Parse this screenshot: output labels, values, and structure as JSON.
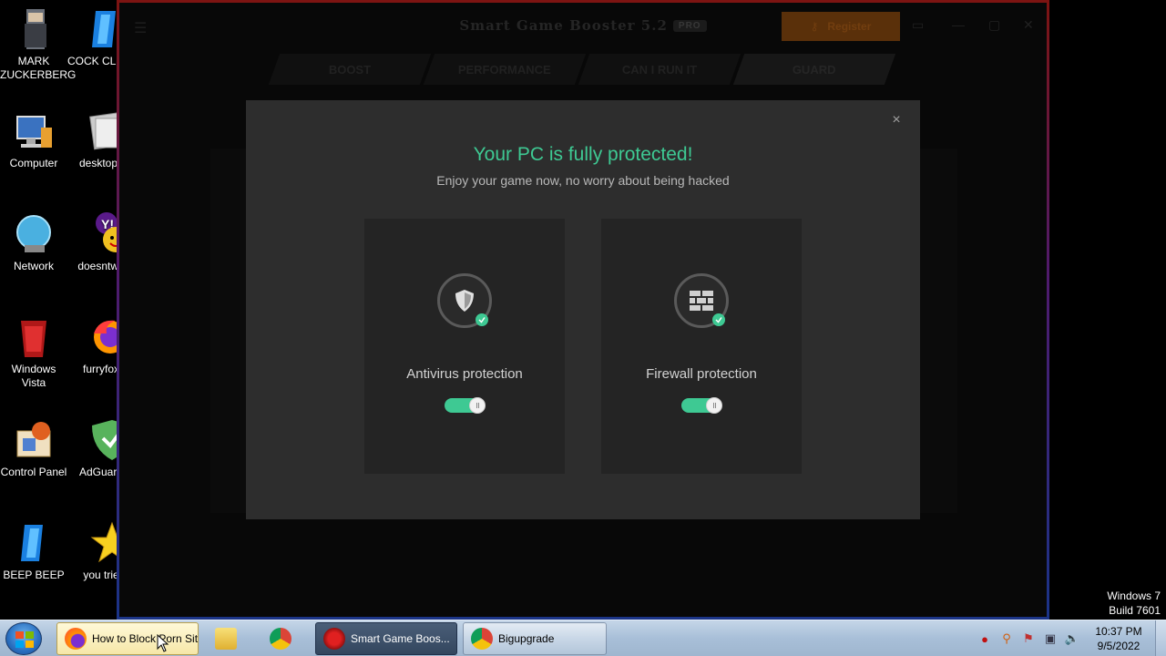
{
  "desktop": {
    "icons": [
      {
        "label": "MARK ZUCKERBERG",
        "icon": "character-icon"
      },
      {
        "label": "COCK CLEANE",
        "icon": "cleaner-icon"
      },
      {
        "label": "Computer",
        "icon": "computer-icon"
      },
      {
        "label": "desktop.i",
        "icon": "file-icon"
      },
      {
        "label": "Network",
        "icon": "network-icon"
      },
      {
        "label": "doesntwo",
        "icon": "yahoo-messenger-icon"
      },
      {
        "label": "Windows Vista",
        "icon": "recycle-bin-icon"
      },
      {
        "label": "furryfox",
        "icon": "firefox-icon"
      },
      {
        "label": "Control Panel",
        "icon": "control-panel-icon"
      },
      {
        "label": "AdGuard",
        "icon": "adguard-icon"
      },
      {
        "label": "BEEP BEEP",
        "icon": "cleaner-icon"
      },
      {
        "label": "you trie",
        "icon": "star-icon"
      }
    ],
    "watermark_line1": "Windows 7",
    "watermark_line2": "Build 7601"
  },
  "game_booster": {
    "title": "Smart Game Booster 5.2",
    "badge": "PRO",
    "register_label": "Register",
    "tabs": [
      "BOOST",
      "PERFORMANCE",
      "CAN I RUN IT",
      "GUARD"
    ],
    "active_tab": "GUARD"
  },
  "dialog": {
    "title": "Your PC is fully protected!",
    "subtitle": "Enjoy your game now, no worry about being hacked",
    "close_glyph": "×",
    "cards": [
      {
        "label": "Antivirus protection",
        "icon": "shield-icon",
        "enabled": true
      },
      {
        "label": "Firewall protection",
        "icon": "brick-wall-icon",
        "enabled": true
      }
    ],
    "accent_color": "#3ec993"
  },
  "taskbar": {
    "items": [
      {
        "label": "How to Block Porn Site",
        "icon": "firefox-icon"
      },
      {
        "label": "",
        "icon": "folder-icon"
      },
      {
        "label": "",
        "icon": "chrome-icon"
      },
      {
        "label": "Smart Game Boos...",
        "icon": "game-booster-icon"
      },
      {
        "label": "Bigupgrade",
        "icon": "chrome-icon"
      }
    ],
    "clock_time": "10:37 PM",
    "clock_date": "9/5/2022"
  }
}
